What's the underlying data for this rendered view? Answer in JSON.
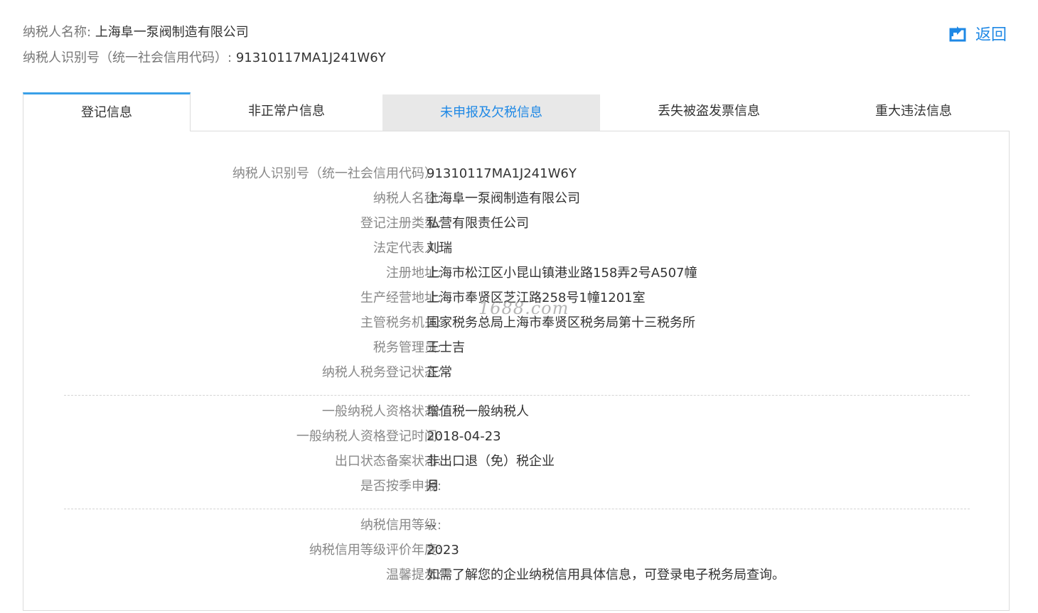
{
  "header": {
    "name_label": "纳税人名称:",
    "name_value": "上海阜一泵阀制造有限公司",
    "id_label": "纳税人识别号（统一社会信用代码）:",
    "id_value": "91310117MA1J241W6Y",
    "back_label": "返回"
  },
  "tabs": [
    {
      "label": "登记信息",
      "state": "active"
    },
    {
      "label": "非正常户信息",
      "state": "normal"
    },
    {
      "label": "未申报及欠税信息",
      "state": "hover"
    },
    {
      "label": "丢失被盗发票信息",
      "state": "normal"
    },
    {
      "label": "重大违法信息",
      "state": "normal"
    }
  ],
  "section1": [
    {
      "label": "纳税人识别号（统一社会信用代码）:",
      "value": "91310117MA1J241W6Y"
    },
    {
      "label": "纳税人名称:",
      "value": "上海阜一泵阀制造有限公司"
    },
    {
      "label": "登记注册类型:",
      "value": "私营有限责任公司"
    },
    {
      "label": "法定代表人:",
      "value": "刘瑞"
    },
    {
      "label": "注册地址:",
      "value": "上海市松江区小昆山镇港业路158弄2号A507幢"
    },
    {
      "label": "生产经营地址:",
      "value": "上海市奉贤区芝江路258号1幢1201室"
    },
    {
      "label": "主管税务机关:",
      "value": "国家税务总局上海市奉贤区税务局第十三税务所"
    },
    {
      "label": "税务管理员:",
      "value": "王士吉"
    },
    {
      "label": "纳税人税务登记状态:",
      "value": "正常"
    }
  ],
  "section2": [
    {
      "label": "一般纳税人资格状态:",
      "value": "增值税一般纳税人"
    },
    {
      "label": "一般纳税人资格登记时间:",
      "value": "2018-04-23"
    },
    {
      "label": "出口状态备案状态:",
      "value": "非出口退（免）税企业"
    },
    {
      "label": "是否按季申报:",
      "value": "月"
    }
  ],
  "section3": [
    {
      "label": "纳税信用等级:",
      "value": "--"
    },
    {
      "label": "纳税信用等级评价年度:",
      "value": "2023"
    },
    {
      "label": "温馨提示:",
      "value": "如需了解您的企业纳税信用具体信息，可登录电子税务局查询。"
    }
  ],
  "watermark": "1688.com",
  "colors": {
    "accent": "#1e88e5",
    "tab_border": "#3aa0e8",
    "label": "#888888"
  }
}
